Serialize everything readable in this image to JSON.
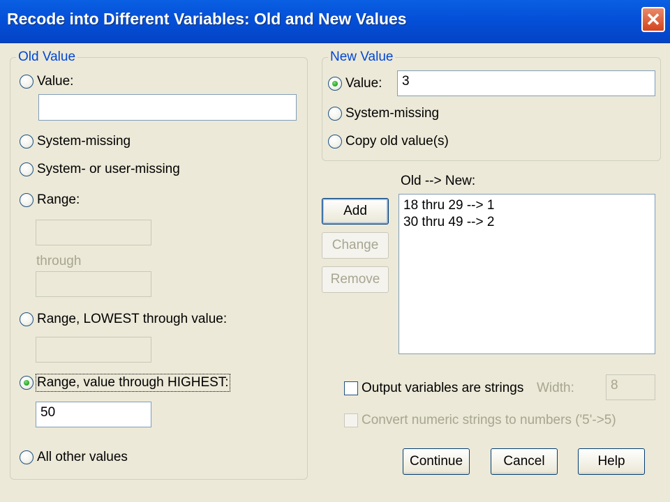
{
  "window": {
    "title": "Recode into Different Variables: Old and New Values",
    "close_glyph": "✕"
  },
  "old_value": {
    "legend": "Old Value",
    "value_label": "Value:",
    "value_input": "",
    "system_missing_label": "System-missing",
    "sys_or_user_missing_label": "System- or user-missing",
    "range_label": "Range:",
    "range_from": "",
    "through_label": "through",
    "range_to": "",
    "range_lowest_label": "Range, LOWEST through value:",
    "range_lowest_input": "",
    "range_highest_label": "Range, value through HIGHEST:",
    "range_highest_input": "50",
    "all_other_label": "All other values",
    "selected": "range_highest"
  },
  "new_value": {
    "legend": "New Value",
    "value_label": "Value:",
    "value_input": "3",
    "system_missing_label": "System-missing",
    "copy_old_label": "Copy old value(s)",
    "selected": "value"
  },
  "mapping": {
    "header": "Old --> New:",
    "items": [
      "18 thru 29 --> 1",
      "30 thru 49 --> 2"
    ]
  },
  "buttons": {
    "add": "Add",
    "change": "Change",
    "remove": "Remove",
    "continue": "Continue",
    "cancel": "Cancel",
    "help": "Help"
  },
  "options": {
    "output_strings_label": "Output variables are strings",
    "output_strings_checked": false,
    "width_label": "Width:",
    "width_value": "8",
    "convert_label": "Convert numeric strings to numbers ('5'->5)",
    "convert_checked": false
  },
  "colors": {
    "titlebar": "#0450d8",
    "legend": "#0046d5",
    "dialog_bg": "#ece9d8"
  }
}
